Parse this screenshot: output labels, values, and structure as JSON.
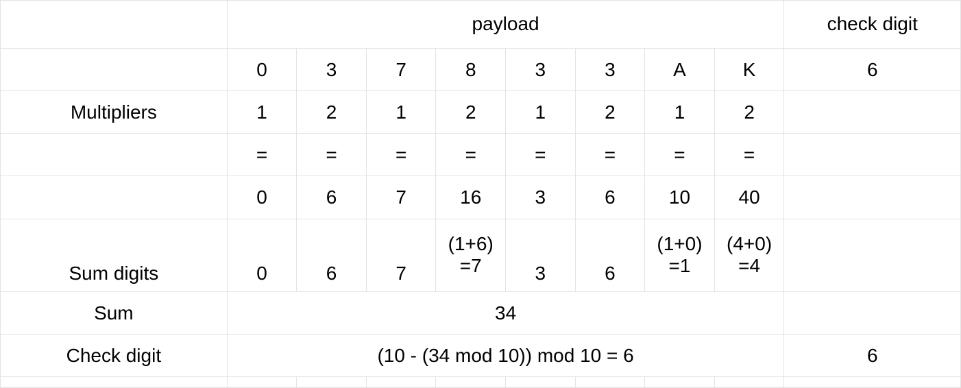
{
  "headers": {
    "payload": "payload",
    "check_digit": "check digit"
  },
  "row_labels": {
    "multipliers": "Multipliers",
    "sum_digits": "Sum digits",
    "sum": "Sum",
    "check_digit": "Check digit"
  },
  "payload_digits": [
    "0",
    "3",
    "7",
    "8",
    "3",
    "3",
    "A",
    "K"
  ],
  "check_digit_value": "6",
  "multipliers": [
    "1",
    "2",
    "1",
    "2",
    "1",
    "2",
    "1",
    "2"
  ],
  "equals_row": [
    "=",
    "=",
    "=",
    "=",
    "=",
    "=",
    "=",
    "="
  ],
  "products": [
    "0",
    "6",
    "7",
    "16",
    "3",
    "6",
    "10",
    "40"
  ],
  "sum_digits": [
    {
      "text": "0"
    },
    {
      "text": "6"
    },
    {
      "text": "7"
    },
    {
      "text": "(1+6)\n=7"
    },
    {
      "text": "3"
    },
    {
      "text": "6"
    },
    {
      "text": "(1+0)\n=1"
    },
    {
      "text": "(4+0)\n=4"
    }
  ],
  "sum_total": "34",
  "check_formula": "(10 - (34 mod 10)) mod 10 = 6",
  "check_result": "6",
  "chart_data": {
    "type": "table",
    "title": "Luhn-style check digit computation",
    "payload": [
      "0",
      "3",
      "7",
      "8",
      "3",
      "3",
      "A",
      "K"
    ],
    "given_check_digit": 6,
    "multipliers": [
      1,
      2,
      1,
      2,
      1,
      2,
      1,
      2
    ],
    "products": [
      0,
      6,
      7,
      16,
      3,
      6,
      10,
      40
    ],
    "digit_sums": [
      0,
      6,
      7,
      7,
      3,
      6,
      1,
      4
    ],
    "sum": 34,
    "formula": "(10 - (34 mod 10)) mod 10",
    "computed_check_digit": 6
  }
}
